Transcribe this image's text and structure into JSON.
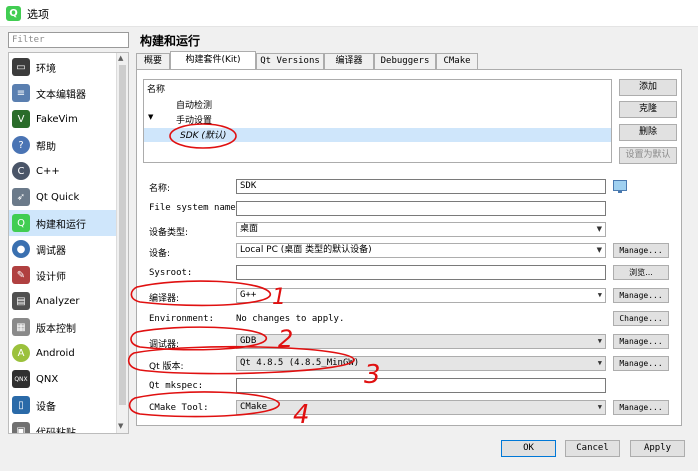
{
  "window": {
    "title": "选项",
    "app_icon": "qt-icon"
  },
  "filter": {
    "placeholder": "Filter"
  },
  "sidebar": {
    "items": [
      {
        "label": "环境",
        "icon": "monitor-icon",
        "color": "#3c3c3c"
      },
      {
        "label": "文本编辑器",
        "icon": "text-editor-icon",
        "color": "#5a7fb0"
      },
      {
        "label": "FakeVim",
        "icon": "fakevim-icon",
        "color": "#2a6c2a"
      },
      {
        "label": "帮助",
        "icon": "help-icon",
        "color": "#4a74b4"
      },
      {
        "label": "C++",
        "icon": "cpp-icon",
        "color": "#4a5568"
      },
      {
        "label": "Qt Quick",
        "icon": "qtquick-icon",
        "color": "#6b7a8a"
      },
      {
        "label": "构建和运行",
        "icon": "build-run-icon",
        "color": "#41cd52"
      },
      {
        "label": "调试器",
        "icon": "debugger-icon",
        "color": "#3a70b0"
      },
      {
        "label": "设计师",
        "icon": "designer-icon",
        "color": "#b04040"
      },
      {
        "label": "Analyzer",
        "icon": "analyzer-icon",
        "color": "#505050"
      },
      {
        "label": "版本控制",
        "icon": "version-control-icon",
        "color": "#8a8a8a"
      },
      {
        "label": "Android",
        "icon": "android-icon",
        "color": "#9bc13c"
      },
      {
        "label": "QNX",
        "icon": "qnx-icon",
        "color": "#303030"
      },
      {
        "label": "设备",
        "icon": "device-icon",
        "color": "#2a6aa8"
      },
      {
        "label": "代码粘贴",
        "icon": "code-paste-icon",
        "color": "#707070"
      }
    ],
    "selected_index": 6
  },
  "main": {
    "heading": "构建和运行",
    "tabs": [
      {
        "label": "概要"
      },
      {
        "label": "构建套件(Kit)"
      },
      {
        "label": "Qt Versions"
      },
      {
        "label": "编译器"
      },
      {
        "label": "Debuggers"
      },
      {
        "label": "CMake"
      }
    ],
    "active_tab": 1,
    "kit_tree": {
      "header": "名称",
      "auto_detect": "自动检测",
      "manual": "手动设置",
      "selected_kit": "SDK (默认)",
      "expand_glyph": "▼"
    },
    "kit_buttons": {
      "add": "添加",
      "clone": "克隆",
      "delete": "删除",
      "make_default": "设置为默认"
    },
    "form": {
      "name_label": "名称:",
      "name_value": "SDK",
      "filesystem_label": "File system name:",
      "filesystem_value": "",
      "device_type_label": "设备类型:",
      "device_type_value": "桌面",
      "device_label": "设备:",
      "device_value": "Local PC (桌面 类型的默认设备)",
      "sysroot_label": "Sysroot:",
      "sysroot_value": "",
      "compiler_label": "编译器:",
      "compiler_value": "G++",
      "environment_label": "Environment:",
      "environment_value": "No changes to apply.",
      "debugger_label": "调试器:",
      "debugger_value": "GDB",
      "qt_version_label": "Qt 版本:",
      "qt_version_value": "Qt 4.8.5 (4.8.5_MinGW)",
      "qt_mkspec_label": "Qt mkspec:",
      "qt_mkspec_value": "",
      "cmake_tool_label": "CMake Tool:",
      "cmake_tool_value": "CMake"
    },
    "side_buttons": {
      "manage": "Manage...",
      "browse": "浏览...",
      "change": "Change..."
    }
  },
  "dialog_buttons": {
    "ok": "OK",
    "cancel": "Cancel",
    "apply": "Apply"
  },
  "annotations": {
    "n1": "1",
    "n2": "2",
    "n3": "3",
    "n4": "4",
    "color": "#e01010"
  }
}
